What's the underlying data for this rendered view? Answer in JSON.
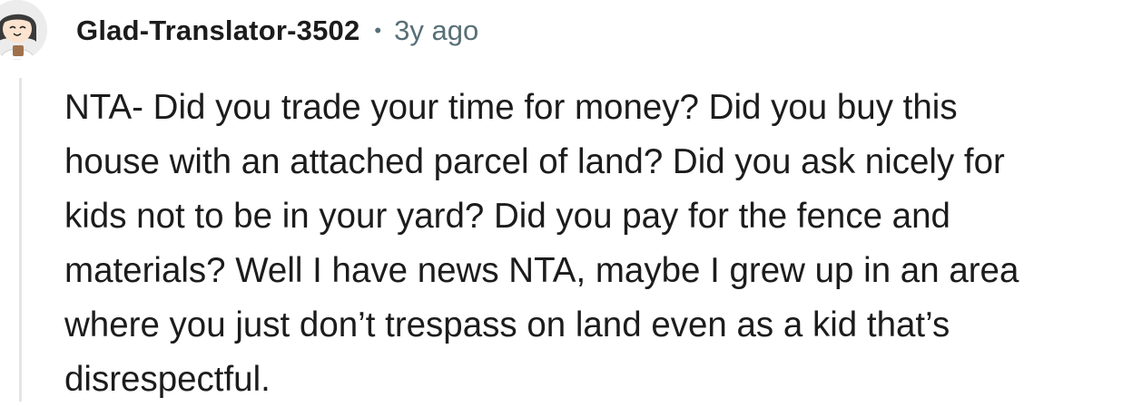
{
  "comment": {
    "username": "Glad-Translator-3502",
    "separator": "•",
    "timestamp": "3y ago",
    "avatar": "avatar-icon",
    "body": "NTA- Did you trade your time for money? Did you buy this\nhouse with an attached parcel of land? Did you ask nicely for\nkids not to be in your yard? Did you pay for the fence and\nmaterials? Well I have news NTA, maybe I grew up in an area\nwhere you just don’t trespass on land even as a kid that’s\ndisrespectful."
  },
  "colors": {
    "text": "#1c1c1c",
    "meta": "#576f76",
    "thread_line": "#e4e4e4"
  }
}
